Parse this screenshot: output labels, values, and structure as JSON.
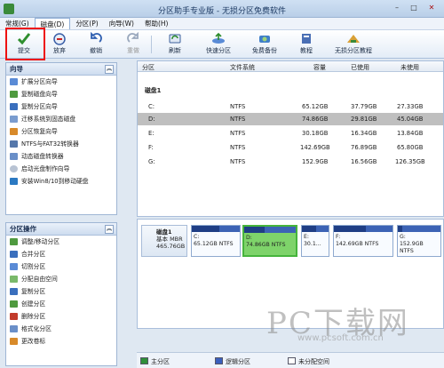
{
  "window": {
    "title": "分区助手专业版 - 无损分区免费软件"
  },
  "menu": [
    {
      "label": "常规(G)"
    },
    {
      "label": "磁盘(D)"
    },
    {
      "label": "分区(P)"
    },
    {
      "label": "向导(W)"
    },
    {
      "label": "帮助(H)"
    }
  ],
  "toolbar": {
    "submit": "提交",
    "discard": "放弃",
    "undo": "撤销",
    "redo": "重做",
    "refresh": "刷新",
    "quick_partition": "快速分区",
    "free_backup": "免费备份",
    "tutorial": "教程",
    "lossless_tutorial": "无损分区教程"
  },
  "wizard_panel": {
    "title": "向导",
    "items": [
      {
        "label": "扩展分区向导"
      },
      {
        "label": "复制磁盘向导"
      },
      {
        "label": "复制分区向导"
      },
      {
        "label": "迁移系统到固态磁盘"
      },
      {
        "label": "分区恢复向导"
      },
      {
        "label": "NTFS与FAT32转换器"
      },
      {
        "label": "动态磁盘转换器"
      },
      {
        "label": "启动光盘制作向导"
      },
      {
        "label": "安装Win8/10到移动硬盘"
      }
    ]
  },
  "partition_panel": {
    "title": "分区操作",
    "items": [
      {
        "label": "调整/移动分区"
      },
      {
        "label": "合并分区"
      },
      {
        "label": "切割分区"
      },
      {
        "label": "分配自由空间"
      },
      {
        "label": "复制分区"
      },
      {
        "label": "创建分区"
      },
      {
        "label": "删除分区"
      },
      {
        "label": "格式化分区"
      },
      {
        "label": "更改卷标"
      }
    ]
  },
  "table": {
    "headers": {
      "partition": "分区",
      "fs": "文件系统",
      "capacity": "容量",
      "used": "已使用",
      "unused": "未使用"
    },
    "disk_title": "磁盘1",
    "rows": [
      {
        "name": "C:",
        "fs": "NTFS",
        "capacity": "65.12GB",
        "used": "37.79GB",
        "unused": "27.33GB"
      },
      {
        "name": "D:",
        "fs": "NTFS",
        "capacity": "74.86GB",
        "used": "29.81GB",
        "unused": "45.04GB"
      },
      {
        "name": "E:",
        "fs": "NTFS",
        "capacity": "30.18GB",
        "used": "16.34GB",
        "unused": "13.84GB"
      },
      {
        "name": "F:",
        "fs": "NTFS",
        "capacity": "142.69GB",
        "used": "76.89GB",
        "unused": "65.80GB"
      },
      {
        "name": "G:",
        "fs": "NTFS",
        "capacity": "152.9GB",
        "used": "16.56GB",
        "unused": "126.35GB"
      }
    ]
  },
  "diskmap": {
    "disk_name": "磁盘1",
    "disk_type": "基本 MBR",
    "disk_size": "465.76GB",
    "parts": [
      {
        "letter": "C:",
        "info": "65.12GB NTFS",
        "used_fraction": 0.58
      },
      {
        "letter": "D:",
        "info": "74.86GB NTFS",
        "used_fraction": 0.4
      },
      {
        "letter": "E:",
        "info": "30.1...",
        "used_fraction": 0.54
      },
      {
        "letter": "F:",
        "info": "142.69GB NTFS",
        "used_fraction": 0.54
      },
      {
        "letter": "G:",
        "info": "152.9GB NTFS",
        "used_fraction": 0.11
      }
    ]
  },
  "legend": {
    "primary": "主分区",
    "logical": "逻辑分区",
    "unallocated": "未分配空间"
  },
  "watermark": {
    "big": "PC下载网",
    "small": "www.pcsoft.com.cn"
  },
  "colors": {
    "selected_part": "#7ed36a",
    "bar": "#3c63b5",
    "highlight": "#e11111"
  }
}
